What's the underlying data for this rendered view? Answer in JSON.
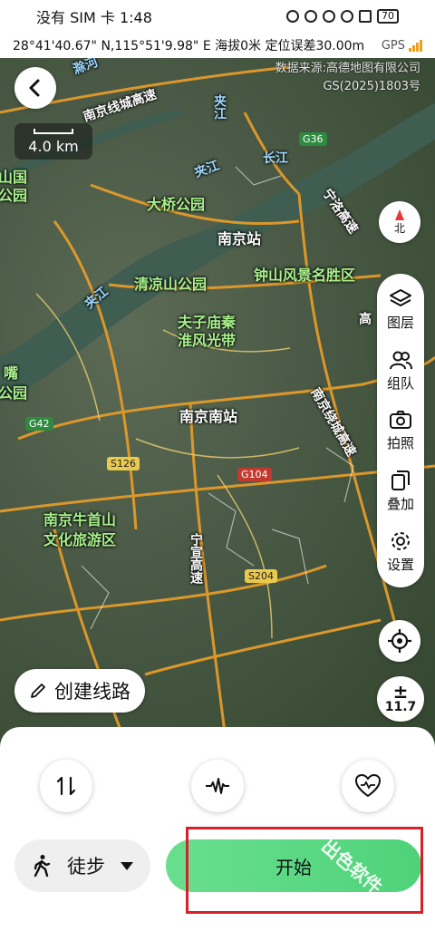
{
  "status": {
    "left": "没有 SIM 卡 1:48",
    "battery": "70"
  },
  "info": {
    "coords": "28°41'40.67\" N,115°51'9.98\" E 海拔0米 定位误差30.00m",
    "gps": "GPS"
  },
  "map": {
    "credit_line1": "数据来源:高德地图有限公司",
    "credit_line2": "GS(2025)1803号",
    "scale": "4.0 km",
    "compass": "北",
    "labels": {
      "nanjing_station": "南京站",
      "daqiao_park": "大桥公园",
      "qingliang_park": "清凉山公园",
      "zhongshan": "钟山风景名胜区",
      "fuzimiao1": "夫子庙秦",
      "fuzimiao2": "淮风光带",
      "nanjing_south": "南京南站",
      "niushou1": "南京牛首山",
      "niushou2": "文化旅游区",
      "changjiang": "长江",
      "jiajiang1": "夹江",
      "jiajiang2": "夹江",
      "jiajiang3": "夹江",
      "chuhe": "滁河",
      "jingjiang": "南京线城高速",
      "ningluo": "宁洛高速",
      "ningxuan": "宁宣高速",
      "nanjing_ring": "南京绕城高速",
      "gaoqiao": "高",
      "edge_left1": "山国",
      "edge_left2": "公园",
      "edge_left3": "嘴",
      "edge_left4": "公园"
    },
    "badges": {
      "g36": "G36",
      "g42": "G42",
      "s126": "S126",
      "g104": "G104",
      "s204": "S204"
    }
  },
  "side_panel": {
    "layers": "图层",
    "team": "组队",
    "photo": "拍照",
    "overlay": "叠加",
    "settings": "设置"
  },
  "zoom_level": "11.7",
  "create_route": "创建线路",
  "bottom": {
    "mode": "徒步",
    "start": "开始",
    "watermark": "出色软件"
  }
}
